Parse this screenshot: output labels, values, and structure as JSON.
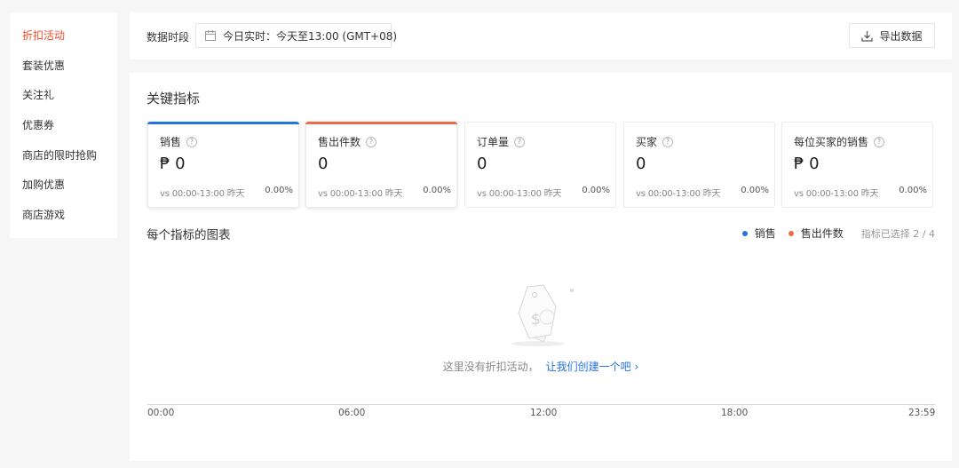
{
  "sidebar": {
    "items": [
      {
        "label": "折扣活动",
        "active": true
      },
      {
        "label": "套装优惠",
        "active": false
      },
      {
        "label": "关注礼",
        "active": false
      },
      {
        "label": "优惠券",
        "active": false
      },
      {
        "label": "商店的限时抢购",
        "active": false
      },
      {
        "label": "加购优惠",
        "active": false
      },
      {
        "label": "商店游戏",
        "active": false
      }
    ]
  },
  "topbar": {
    "period_label": "数据时段",
    "period_value": "今日实时：今天至13:00 (GMT+08)",
    "export_label": "导出数据"
  },
  "metrics": {
    "title": "关键指标",
    "cards": [
      {
        "label": "销售",
        "value": "₱ 0",
        "compare": "vs 00:00-13:00 昨天",
        "pct": "0.00%",
        "selected": true,
        "color": "#2673dd"
      },
      {
        "label": "售出件数",
        "value": "0",
        "compare": "vs 00:00-13:00 昨天",
        "pct": "0.00%",
        "selected": true,
        "color": "#ee6a4a"
      },
      {
        "label": "订单量",
        "value": "0",
        "compare": "vs 00:00-13:00 昨天",
        "pct": "0.00%",
        "selected": false,
        "color": ""
      },
      {
        "label": "买家",
        "value": "0",
        "compare": "vs 00:00-13:00 昨天",
        "pct": "0.00%",
        "selected": false,
        "color": ""
      },
      {
        "label": "每位买家的销售",
        "value": "₱ 0",
        "compare": "vs 00:00-13:00 昨天",
        "pct": "0.00%",
        "selected": false,
        "color": ""
      }
    ]
  },
  "chart": {
    "title": "每个指标的图表",
    "legend": [
      {
        "label": "销售",
        "color": "#2673dd"
      },
      {
        "label": "售出件数",
        "color": "#ee6a4a"
      }
    ],
    "selected_count": "指标已选择 2 / 4",
    "empty_text": "这里没有折扣活动，",
    "empty_link": "让我们创建一个吧",
    "x_ticks": [
      "00:00",
      "06:00",
      "12:00",
      "18:00",
      "23:59"
    ]
  }
}
